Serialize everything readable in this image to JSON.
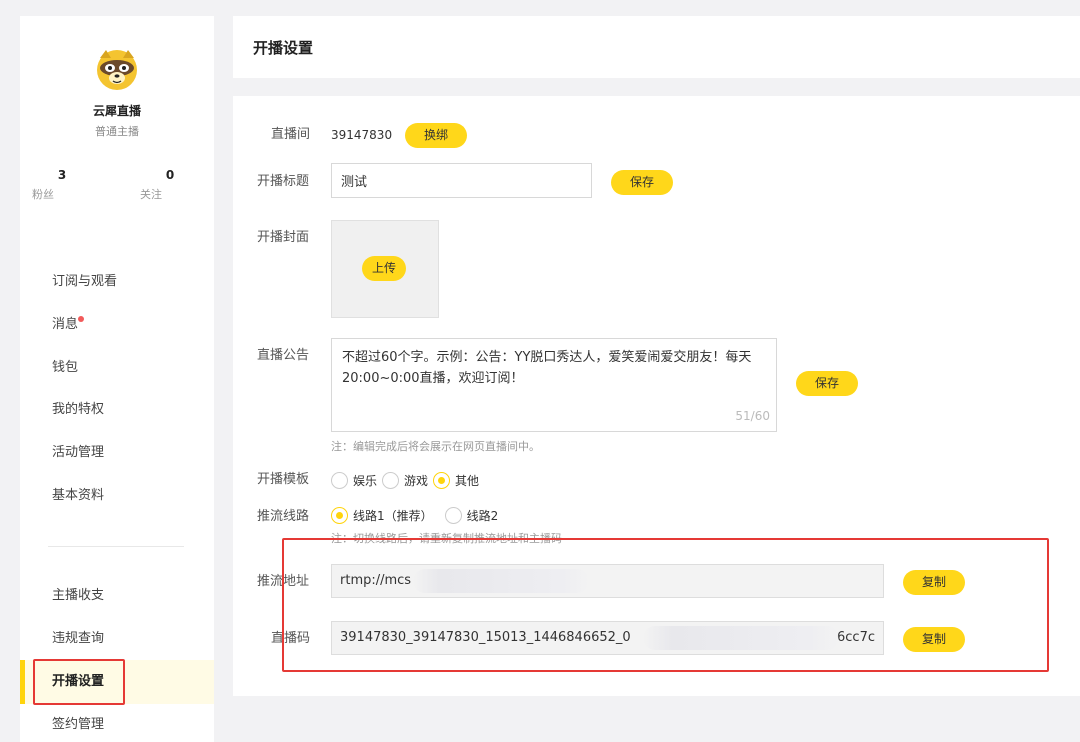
{
  "sidebar": {
    "username": "云犀直播",
    "role": "普通主播",
    "stats": [
      {
        "num": "3",
        "label": "粉丝"
      },
      {
        "num": "0",
        "label": "关注"
      }
    ],
    "menu_top": [
      "订阅与观看",
      "消息",
      "钱包",
      "我的特权",
      "活动管理",
      "基本资料"
    ],
    "menu_bottom": [
      "主播收支",
      "违规查询",
      "开播设置",
      "签约管理"
    ],
    "active_item": "开播设置",
    "unread_dot_color": "#f25a5a"
  },
  "header": {
    "title": "开播设置"
  },
  "form": {
    "room": {
      "label": "直播间",
      "value": "39147830",
      "button": "换绑"
    },
    "title": {
      "label": "开播标题",
      "value": "测试",
      "button": "保存"
    },
    "cover": {
      "label": "开播封面",
      "button": "上传"
    },
    "notice": {
      "label": "直播公告",
      "value": "不超过60个字。示例：公告：YY脱口秀达人，爱笑爱闹爱交朋友！每天20:00~0:00直播，欢迎订阅！",
      "counter": "51/60",
      "button": "保存",
      "note": "注：编辑完成后将会展示在网页直播间中。"
    },
    "template": {
      "label": "开播模板",
      "options": [
        "娱乐",
        "游戏",
        "其他"
      ],
      "selected": "其他"
    },
    "route": {
      "label": "推流线路",
      "options": [
        "线路1（推荐）",
        "线路2"
      ],
      "selected": "线路1（推荐）",
      "note": "注：切换线路后，请重新复制推流地址和主播码"
    },
    "stream_url": {
      "label": "推流地址",
      "value": "rtmp://mcs",
      "button": "复制"
    },
    "stream_key": {
      "label": "直播码",
      "value": "39147830_39147830_15013_1446846652_0",
      "tail": "6cc7c",
      "button": "复制"
    }
  },
  "colors": {
    "accent": "#ffd40c",
    "highlight_border": "#e53935"
  }
}
